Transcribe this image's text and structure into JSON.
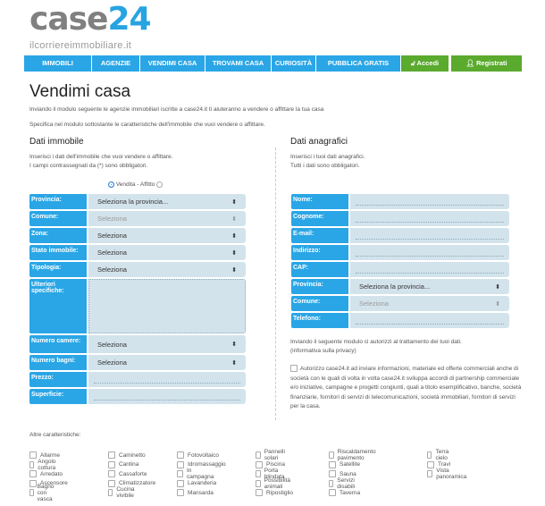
{
  "logo": {
    "main": "case",
    "accent": "24",
    "tagline": "ilcorriereimmobiliare.it"
  },
  "nav": [
    "IMMOBILI",
    "AGENZIE",
    "VENDIMI CASA",
    "TROVAMI CASA",
    "CURIOSITÀ",
    "PUBBLICA GRATIS"
  ],
  "nav_accedi": "Accedi",
  "nav_registrati": "Registrati",
  "colors": {
    "brand": "#2aa6e6",
    "green": "#5aaa2e",
    "field": "#d3e3ec"
  },
  "title": "Vendimi casa",
  "intro1": "Inviando il modulo seguente le agenzie immobiliari iscritte a case24.it ti aiuteranno a vendere o affittare la tua casa",
  "intro2": "Specifica nel modulo sottostante le caratteristiche dell'immobile che vuoi vendere o affittare.",
  "left": {
    "heading": "Dati immobile",
    "sub1": "Inserisci i dati dell'immobile che vuoi vendere o affittare.",
    "sub2": "I campi contrassegnati da (*) sono obbligatori.",
    "radio_label": "Vendita - Affitto",
    "rows": [
      {
        "label": "Provincia:",
        "value": "Seleziona la provincia..."
      },
      {
        "label": "Comune:",
        "value": "Seleziona"
      },
      {
        "label": "Zona:",
        "value": "Seleziona"
      },
      {
        "label": "Stato immobile:",
        "value": "Seleziona"
      },
      {
        "label": "Tipologia:",
        "value": "Seleziona"
      },
      {
        "label": "Ulteriori specifiche:",
        "value": ""
      },
      {
        "label": "Numero camere:",
        "value": "Seleziona"
      },
      {
        "label": "Numero bagni:",
        "value": "Seleziona"
      },
      {
        "label": "Prezzo:",
        "value": ""
      },
      {
        "label": "Superficie:",
        "value": ""
      }
    ]
  },
  "right": {
    "heading": "Dati anagrafici",
    "sub1": "Inserisci i tuoi dati anagrafici.",
    "sub2": "Tutti i dati sono obbligatori.",
    "rows": [
      {
        "label": "Nome:",
        "value": ""
      },
      {
        "label": "Cognome:",
        "value": ""
      },
      {
        "label": "E-mail:",
        "value": ""
      },
      {
        "label": "Indirizzo:",
        "value": ""
      },
      {
        "label": "CAP:",
        "value": ""
      },
      {
        "label": "Provincia:",
        "value": "Seleziona la provincia..."
      },
      {
        "label": "Comune:",
        "value": "Seleziona"
      },
      {
        "label": "Telefono:",
        "value": ""
      }
    ],
    "privacy1": "Inviando il seguente modulo ci autorizzi al trattamento dei tuoi dati.",
    "privacy2": "(informativa sulla privacy)",
    "consent": "Autorizzo case24.it ad inviare informazioni, materiale ed offerte commerciali anche di società con le quali di volta in volta case24.it sviluppa accordi di partnership commerciale e/o iniziative, campagne e progetti congiunti, quali a titolo esemplificativo, banche, società finanziarie, fornitori di servizi di telecomunicazioni, società immobiliari, fornitori di servizi per la casa."
  },
  "altre": {
    "label": "Altre caratteristiche:",
    "columns": [
      [
        "Allarme",
        "Angolo cottura",
        "Arredato",
        "Ascensore",
        "Bagno con vasca"
      ],
      [
        "Caminetto",
        "Cantina",
        "Cassaforte",
        "Climatizzatore",
        "Cucina vivibile"
      ],
      [
        "Fotovoltaico",
        "Idromassaggio",
        "In campagna",
        "Lavanderia",
        "Mansarda"
      ],
      [
        "Pannelli solari",
        "Piscina",
        "Porta blindata",
        "Possibilità animali",
        "Ripostiglio"
      ],
      [
        "Riscaldamento pavimento",
        "Satellite",
        "Sauna",
        "Servizi disabili",
        "Taverna"
      ],
      [
        "Terra cielo",
        "Travi",
        "Vista panoramica"
      ]
    ]
  }
}
